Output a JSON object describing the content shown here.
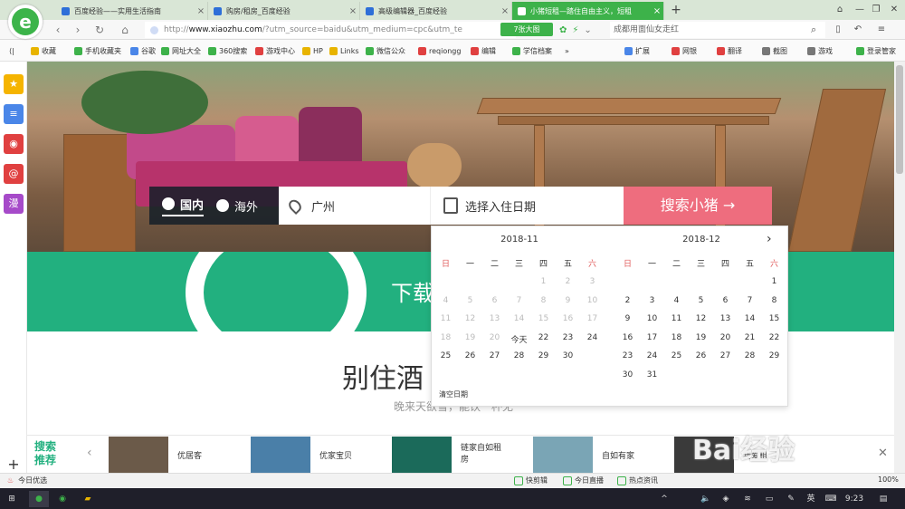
{
  "tabs": [
    {
      "title": "百度经验——实用生活指南",
      "active": false
    },
    {
      "title": "购房/租房_百度经验",
      "active": false
    },
    {
      "title": "高级编辑器_百度经验",
      "active": false
    },
    {
      "title": "小猪短租—踏住自由主义，短租",
      "active": true
    }
  ],
  "address": {
    "scheme": "http://",
    "host": "www.xiaozhu.com",
    "path": "/?utm_source=baidu&utm_medium=cpc&utm_te"
  },
  "toolbar": {
    "big_image_btn": "7张大图",
    "search_text": "成都用面仙女走红"
  },
  "bookmarks": [
    {
      "label": "收藏",
      "color": "#e8b400"
    },
    {
      "label": "手机收藏夹",
      "color": "#3db24a"
    },
    {
      "label": "谷歌",
      "color": "#4a86e8"
    },
    {
      "label": "网址大全",
      "color": "#3db24a"
    },
    {
      "label": "360搜索",
      "color": "#3db24a"
    },
    {
      "label": "游戏中心",
      "color": "#e04040"
    },
    {
      "label": "HP",
      "color": "#e8b400"
    },
    {
      "label": "Links",
      "color": "#e8b400"
    },
    {
      "label": "微信公众",
      "color": "#3db24a"
    },
    {
      "label": "reqiongg",
      "color": "#e04040"
    },
    {
      "label": "编辑",
      "color": "#e04040"
    },
    {
      "label": "学信档案",
      "color": "#3db24a"
    }
  ],
  "bookmarks_more": "»",
  "right_tools": [
    {
      "label": "扩展"
    },
    {
      "label": "网银"
    },
    {
      "label": "翻译"
    },
    {
      "label": "截图"
    },
    {
      "label": "游戏"
    },
    {
      "label": "登录管家"
    }
  ],
  "search": {
    "region_domestic": "国内",
    "region_overseas": "海外",
    "city": "广州",
    "date_placeholder": "选择入住日期",
    "button": "搜索小猪 →"
  },
  "calendar": {
    "weekdays": [
      "日",
      "一",
      "二",
      "三",
      "四",
      "五",
      "六"
    ],
    "left": {
      "title": "2018-11",
      "rows": [
        [
          {
            "d": "",
            "c": "g"
          },
          {
            "d": "",
            "c": "g"
          },
          {
            "d": "",
            "c": "g"
          },
          {
            "d": "",
            "c": "g"
          },
          {
            "d": "1",
            "c": "g"
          },
          {
            "d": "2",
            "c": "g"
          },
          {
            "d": "3",
            "c": "g"
          }
        ],
        [
          {
            "d": "4",
            "c": "g"
          },
          {
            "d": "5",
            "c": "g"
          },
          {
            "d": "6",
            "c": "g"
          },
          {
            "d": "7",
            "c": "g"
          },
          {
            "d": "8",
            "c": "g"
          },
          {
            "d": "9",
            "c": "g"
          },
          {
            "d": "10",
            "c": "g"
          }
        ],
        [
          {
            "d": "11",
            "c": "g"
          },
          {
            "d": "12",
            "c": "g"
          },
          {
            "d": "13",
            "c": "g"
          },
          {
            "d": "14",
            "c": "g"
          },
          {
            "d": "15",
            "c": "g"
          },
          {
            "d": "16",
            "c": "g"
          },
          {
            "d": "17",
            "c": "g"
          }
        ],
        [
          {
            "d": "18",
            "c": "g"
          },
          {
            "d": "19",
            "c": "g"
          },
          {
            "d": "20",
            "c": "g"
          },
          {
            "d": "今天",
            "c": "d"
          },
          {
            "d": "22",
            "c": "d"
          },
          {
            "d": "23",
            "c": "d"
          },
          {
            "d": "24",
            "c": "d"
          }
        ],
        [
          {
            "d": "25",
            "c": "d"
          },
          {
            "d": "26",
            "c": "d"
          },
          {
            "d": "27",
            "c": "d"
          },
          {
            "d": "28",
            "c": "d"
          },
          {
            "d": "29",
            "c": "d"
          },
          {
            "d": "30",
            "c": "d"
          },
          {
            "d": "",
            "c": "d"
          }
        ]
      ]
    },
    "right": {
      "title": "2018-12",
      "rows": [
        [
          {
            "d": "",
            "c": "d"
          },
          {
            "d": "",
            "c": "d"
          },
          {
            "d": "",
            "c": "d"
          },
          {
            "d": "",
            "c": "d"
          },
          {
            "d": "",
            "c": "d"
          },
          {
            "d": "",
            "c": "d"
          },
          {
            "d": "1",
            "c": "d"
          }
        ],
        [
          {
            "d": "2",
            "c": "d"
          },
          {
            "d": "3",
            "c": "d"
          },
          {
            "d": "4",
            "c": "d"
          },
          {
            "d": "5",
            "c": "d"
          },
          {
            "d": "6",
            "c": "d"
          },
          {
            "d": "7",
            "c": "d"
          },
          {
            "d": "8",
            "c": "d"
          }
        ],
        [
          {
            "d": "9",
            "c": "d"
          },
          {
            "d": "10",
            "c": "d"
          },
          {
            "d": "11",
            "c": "d"
          },
          {
            "d": "12",
            "c": "d"
          },
          {
            "d": "13",
            "c": "d"
          },
          {
            "d": "14",
            "c": "d"
          },
          {
            "d": "15",
            "c": "d"
          }
        ],
        [
          {
            "d": "16",
            "c": "d"
          },
          {
            "d": "17",
            "c": "d"
          },
          {
            "d": "18",
            "c": "d"
          },
          {
            "d": "19",
            "c": "d"
          },
          {
            "d": "20",
            "c": "d"
          },
          {
            "d": "21",
            "c": "d"
          },
          {
            "d": "22",
            "c": "d"
          }
        ],
        [
          {
            "d": "23",
            "c": "d"
          },
          {
            "d": "24",
            "c": "d"
          },
          {
            "d": "25",
            "c": "d"
          },
          {
            "d": "26",
            "c": "d"
          },
          {
            "d": "27",
            "c": "d"
          },
          {
            "d": "28",
            "c": "d"
          },
          {
            "d": "29",
            "c": "d"
          }
        ],
        [
          {
            "d": "30",
            "c": "d"
          },
          {
            "d": "31",
            "c": "d"
          },
          {
            "d": "",
            "c": "d"
          },
          {
            "d": "",
            "c": "d"
          },
          {
            "d": "",
            "c": "d"
          },
          {
            "d": "",
            "c": "d"
          },
          {
            "d": "",
            "c": "d"
          }
        ]
      ]
    },
    "clear": "清空日期"
  },
  "banner": {
    "download_text": "下载",
    "slogan": "别住酒",
    "subslogan": "晚来天欲雪，能饮一杯无"
  },
  "recommend": {
    "label": "搜索推荐",
    "items": [
      {
        "label": "优居客",
        "thumb": "#6b5a49"
      },
      {
        "label": "优家宝贝",
        "thumb": "#4a7fa8"
      },
      {
        "label": "链家自如租房",
        "thumb": "#1b6a5a"
      },
      {
        "label": "自如有家",
        "thumb": "#7aa5b5"
      },
      {
        "label": "我爱租",
        "thumb": "#3a3a3a"
      }
    ]
  },
  "watermark": "Bai经验",
  "statusbar": {
    "left": "今日优选",
    "items": [
      "快剪辑",
      "今日直播",
      "热点资讯"
    ],
    "zoom": "100%"
  },
  "taskbar": {
    "ime": "英",
    "time": "9:23"
  },
  "colors": {
    "brand_green": "#22b07f",
    "browser_green": "#3db24a",
    "search_pink": "#ee6d7e"
  }
}
